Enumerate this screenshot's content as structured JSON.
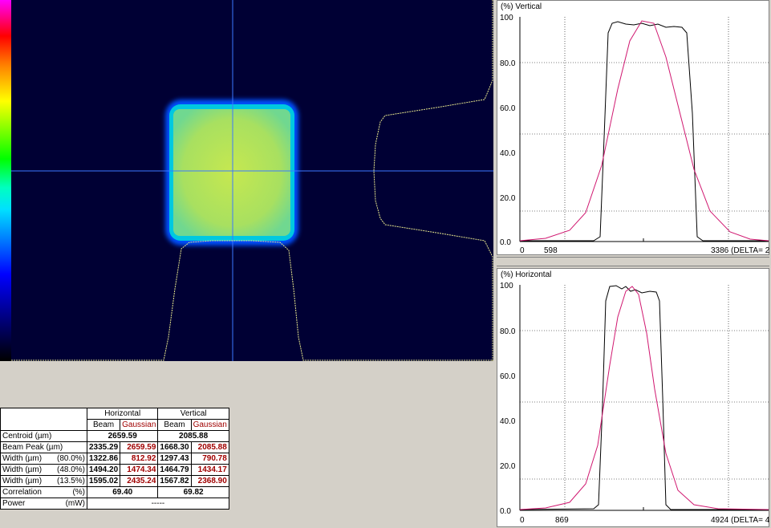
{
  "vertical_plot": {
    "title": "(%) Vertical",
    "y_ticks": [
      "100",
      "80.0",
      "60.0",
      "40.0",
      "20.0",
      "0.0"
    ],
    "x_ticks": [
      "0",
      "598",
      "3386 (DELTA= 2"
    ]
  },
  "horizontal_plot": {
    "title": "(%) Horizontal",
    "y_ticks": [
      "100",
      "80.0",
      "60.0",
      "40.0",
      "20.0",
      "0.0"
    ],
    "x_ticks": [
      "0",
      "869",
      "4924 (DELTA= 4"
    ]
  },
  "results": {
    "group_headers": [
      "Horizontal",
      "Vertical"
    ],
    "sub_headers": [
      "Beam",
      "Gaussian",
      "Beam",
      "Gaussian"
    ],
    "centroid": {
      "label": "Centroid  (µm)",
      "h": "2659.59",
      "v": "2085.88"
    },
    "beam_peak": {
      "label": "Beam Peak (µm)",
      "values": [
        "2335.29",
        "2659.59",
        "1668.30",
        "2085.88"
      ]
    },
    "width_80": {
      "label": "Width (µm)",
      "clip": "(80.0%)",
      "values": [
        "1322.86",
        "812.92",
        "1297.43",
        "790.78"
      ]
    },
    "width_48": {
      "label": "Width (µm)",
      "clip": "(48.0%)",
      "values": [
        "1494.20",
        "1474.34",
        "1464.79",
        "1434.17"
      ]
    },
    "width_13": {
      "label": "Width (µm)",
      "clip": "(13.5%)",
      "values": [
        "1595.02",
        "2435.24",
        "1567.82",
        "2368.90"
      ]
    },
    "correlation": {
      "label": "Correlation",
      "unit": "(%)",
      "h": "69.40",
      "v": "69.82"
    },
    "power": {
      "label": "Power",
      "unit": "(mW)",
      "value": "-----"
    }
  },
  "colors": {
    "beam_bg": "#000034",
    "crosshair": "#3c78ff",
    "profile": "#e6e68c",
    "gaussian_fit": "#d01870",
    "gaussian_text": "#a00000"
  }
}
